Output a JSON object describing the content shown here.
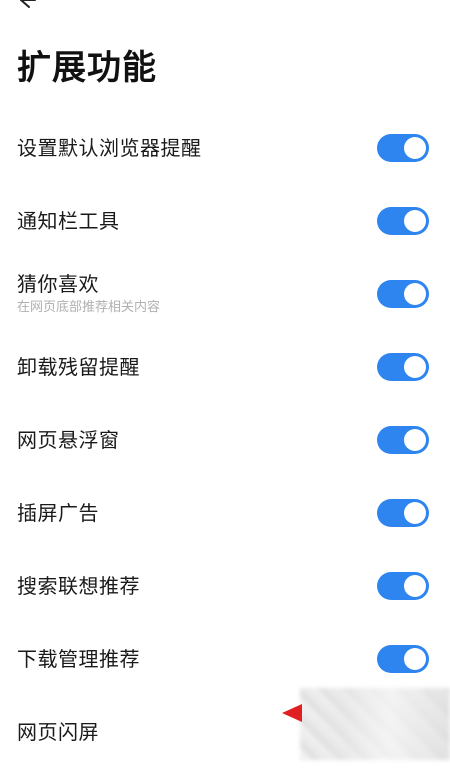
{
  "header": {
    "title": "扩展功能",
    "back_icon": "back-arrow-icon"
  },
  "settings": [
    {
      "label": "设置默认浏览器提醒",
      "subtitle": "",
      "enabled": true
    },
    {
      "label": "通知栏工具",
      "subtitle": "",
      "enabled": true
    },
    {
      "label": "猜你喜欢",
      "subtitle": "在网页底部推荐相关内容",
      "enabled": true
    },
    {
      "label": "卸载残留提醒",
      "subtitle": "",
      "enabled": true
    },
    {
      "label": "网页悬浮窗",
      "subtitle": "",
      "enabled": true
    },
    {
      "label": "插屏广告",
      "subtitle": "",
      "enabled": true
    },
    {
      "label": "搜索联想推荐",
      "subtitle": "",
      "enabled": true
    },
    {
      "label": "下载管理推荐",
      "subtitle": "",
      "enabled": true
    },
    {
      "label": "网页闪屏",
      "subtitle": "",
      "enabled": null
    }
  ],
  "colors": {
    "toggle_on": "#2e85f0",
    "annotation_arrow": "#e02020"
  }
}
